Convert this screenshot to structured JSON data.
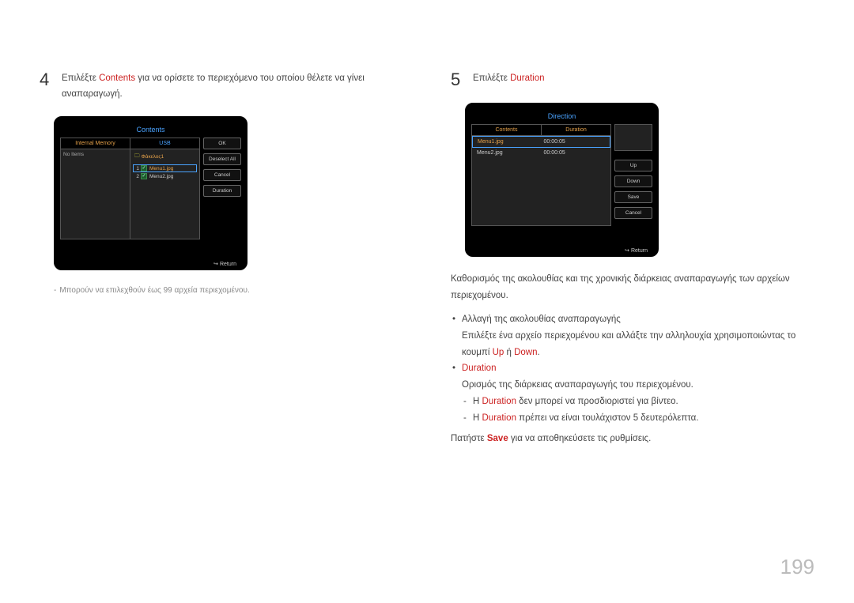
{
  "left": {
    "step_num": "4",
    "step_pre": "Επιλέξτε ",
    "step_red": "Contents",
    "step_post": " για να ορίσετε το περιεχόμενο του οποίου θέλετε να γίνει αναπαραγωγή.",
    "footnote_dash": "-",
    "footnote": "Μπορούν να επιλεχθούν έως 99 αρχεία περιεχομένου."
  },
  "right": {
    "step_num": "5",
    "step_pre": "Επιλέξτε ",
    "step_red": "Duration",
    "para1": "Καθορισμός της ακολουθίας και της χρονικής διάρκειας αναπαραγωγής των αρχείων περιεχομένου.",
    "bullet1": "Αλλαγή της ακολουθίας αναπαραγωγής",
    "bullet1_sub_a": "Επιλέξτε ένα αρχείο περιεχομένου και αλλάξτε την αλληλουχία χρησιμοποιώντας το κουμπί ",
    "bullet1_sub_up": "Up",
    "bullet1_sub_or": " ή ",
    "bullet1_sub_down": "Down",
    "bullet1_sub_end": ".",
    "bullet2": "Duration",
    "bullet2_sub": "Ορισμός της διάρκειας αναπαραγωγής του περιεχομένου.",
    "dash1_pre": "Η ",
    "dash1_red": "Duration",
    "dash1_post": " δεν μπορεί να προσδιοριστεί για βίντεο.",
    "dash2_pre": "Η ",
    "dash2_red": "Duration",
    "dash2_post": " πρέπει να είναι τουλάχιστον 5 δευτερόλεπτα.",
    "final_pre": "Πατήστε ",
    "final_red": "Save",
    "final_post": " για να αποθηκεύσετε τις ρυθμίσεις."
  },
  "device1": {
    "title": "Contents",
    "tab1": "Internal Memory",
    "tab2": "USB",
    "no_items": "No Items",
    "folder": "Φάκελος1",
    "row1_num": "1",
    "row1_name": "Menu1.jpg",
    "row2_num": "2",
    "row2_name": "Menu2.jpg",
    "btn_ok": "OK",
    "btn_deselect": "Deselect All",
    "btn_cancel": "Cancel",
    "btn_duration": "Duration",
    "return": "Return"
  },
  "device2": {
    "title": "Direction",
    "col1": "Contents",
    "col2": "Duration",
    "r1c1": "Menu1.jpg",
    "r1c2": "00:00:05",
    "r2c1": "Menu2.jpg",
    "r2c2": "00:00:05",
    "btn_up": "Up",
    "btn_down": "Down",
    "btn_save": "Save",
    "btn_cancel": "Cancel",
    "return": "Return"
  },
  "page_number": "199"
}
